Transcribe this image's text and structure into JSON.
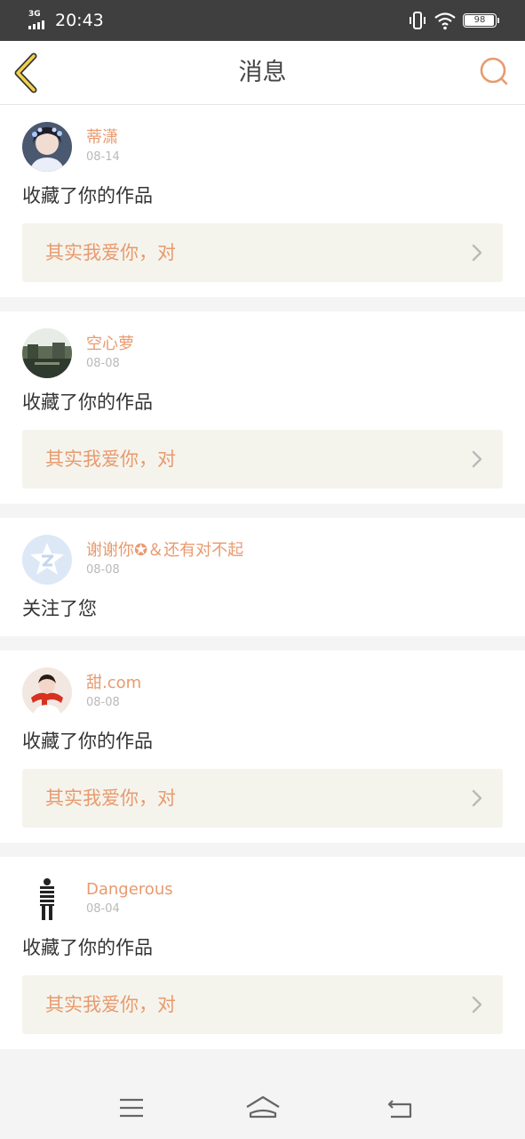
{
  "status_bar": {
    "network": "3G",
    "time": "20:43",
    "battery": "98",
    "icons": [
      "signal-icon",
      "vibrate-icon",
      "wifi-icon",
      "battery-icon"
    ]
  },
  "nav": {
    "title": "消息",
    "back_icon": "chevron-left-icon",
    "search_icon": "search-icon",
    "accent_color": "#e89a6f"
  },
  "messages": [
    {
      "user": "蒂潇",
      "date": "08-14",
      "action": "收藏了你的作品",
      "work": "其实我爱你，对"
    },
    {
      "user": "空心萝",
      "date": "08-08",
      "action": "收藏了你的作品",
      "work": "其实我爱你，对"
    },
    {
      "user": "谢谢你✪＆还有对不起",
      "date": "08-08",
      "action": "关注了您"
    },
    {
      "user": "甜.com",
      "date": "08-08",
      "action": "收藏了你的作品",
      "work": "其实我爱你，对"
    },
    {
      "user": "Dangerous",
      "date": "08-04",
      "action": "收藏了你的作品",
      "work": "其实我爱你，对"
    }
  ],
  "system_nav": {
    "menu_icon": "menu-icon",
    "home_icon": "home-icon",
    "back_icon": "back-arrow-icon"
  }
}
